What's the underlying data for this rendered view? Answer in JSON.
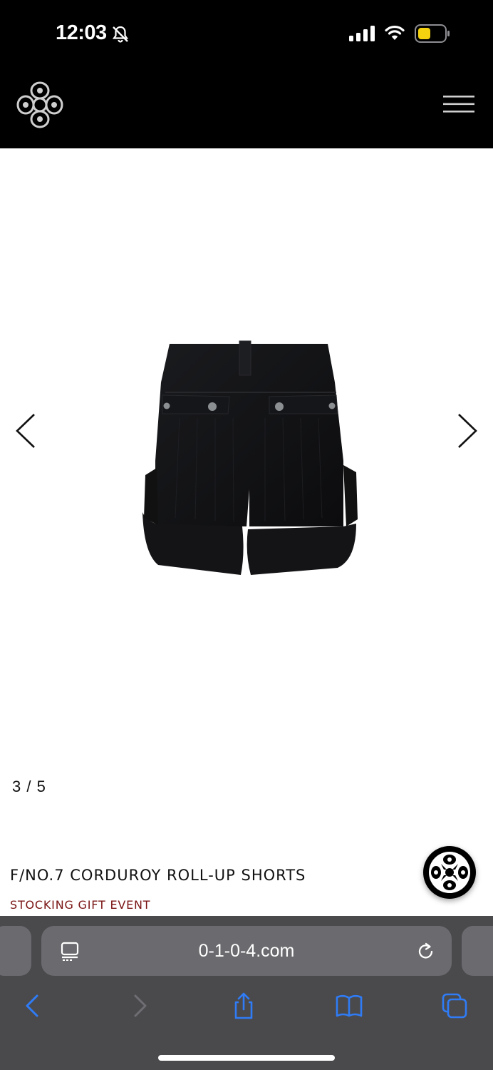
{
  "status_bar": {
    "time": "12:03",
    "icons": [
      "bell-slash-icon",
      "cellular-signal-icon",
      "wifi-icon",
      "battery-low-power-icon"
    ],
    "battery_color": "#f5d20f"
  },
  "header": {
    "logo": "brand-logo",
    "menu_icon": "hamburger-menu-icon"
  },
  "gallery": {
    "counter": "3 / 5",
    "image": "corduroy-shorts-back-view",
    "prev_icon": "chevron-left-icon",
    "next_icon": "chevron-right-icon"
  },
  "product": {
    "title": "F/NO.7 CORDUROY ROLL-UP SHORTS",
    "event": "STOCKING GIFT EVENT",
    "event_color": "#7a1414"
  },
  "chat_widget": {
    "icon": "chat-logo-icon"
  },
  "browser": {
    "url": "0-1-0-4.com",
    "icons": [
      "reader-mode-icon",
      "reload-icon",
      "back-icon",
      "forward-icon",
      "share-icon",
      "bookmarks-icon",
      "tabs-icon"
    ],
    "accent_color": "#2f7cf6"
  }
}
